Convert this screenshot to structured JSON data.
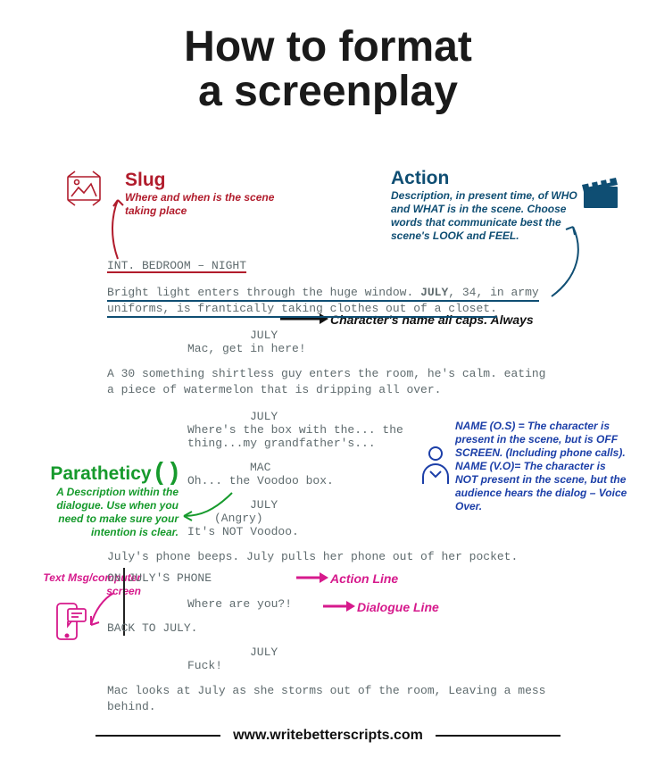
{
  "title_line1": "How to format",
  "title_line2": "a screenplay",
  "footer": "www.writebetterscripts.com",
  "labels": {
    "slug": {
      "heading": "Slug",
      "desc": "Where and when is the scene taking place"
    },
    "action": {
      "heading": "Action",
      "desc": "Description, in present time, of WHO and WHAT is in the scene. Choose words that communicate best the scene's LOOK and FEEL."
    },
    "character_caps": "Character's name all caps. Always",
    "parathetic": {
      "heading": "Paratheticy",
      "glyph": "( )",
      "desc": "A Description within the dialogue. Use when you need to make sure your intention is clear."
    },
    "os_vo": "NAME (O.S) = The character is present in the scene, but is OFF SCREEN. (Including phone calls).\nNAME (V.O)= The character is NOT present in the scene, but the audience hears the dialog – Voice Over.",
    "txtscreen": "Text Msg/computer screen",
    "action_line": "Action Line",
    "dialogue_line": "Dialogue Line"
  },
  "script": {
    "slug": "INT. BEDROOM – NIGHT",
    "a1_pre": "Bright light enters through the huge window. ",
    "a1_bold": "JULY",
    "a1_post": ", 34, in army uniforms, is frantically taking clothes out of a closet.",
    "c1": "JULY",
    "d1": "Mac, get in here!",
    "a2": "A 30 something shirtless guy enters the room, he's calm. eating a piece of watermelon that is dripping all over.",
    "c2": "JULY",
    "d2": "Where's the box with the... the thing...my grandfather's...",
    "c3": "MAC",
    "d3": "Oh... the Voodoo box.",
    "c4": "JULY",
    "p4": "(Angry)",
    "d4": "It's NOT Voodoo.",
    "a3": "July's phone beeps. July pulls her phone out of her pocket.",
    "onphone": "ON JULY'S PHONE",
    "d5": "Where are you?!",
    "back": "BACK TO JULY.",
    "c5": "JULY",
    "d6": "Fuck!",
    "a4": "Mac looks at July as she storms out of the room, Leaving a mess behind."
  }
}
